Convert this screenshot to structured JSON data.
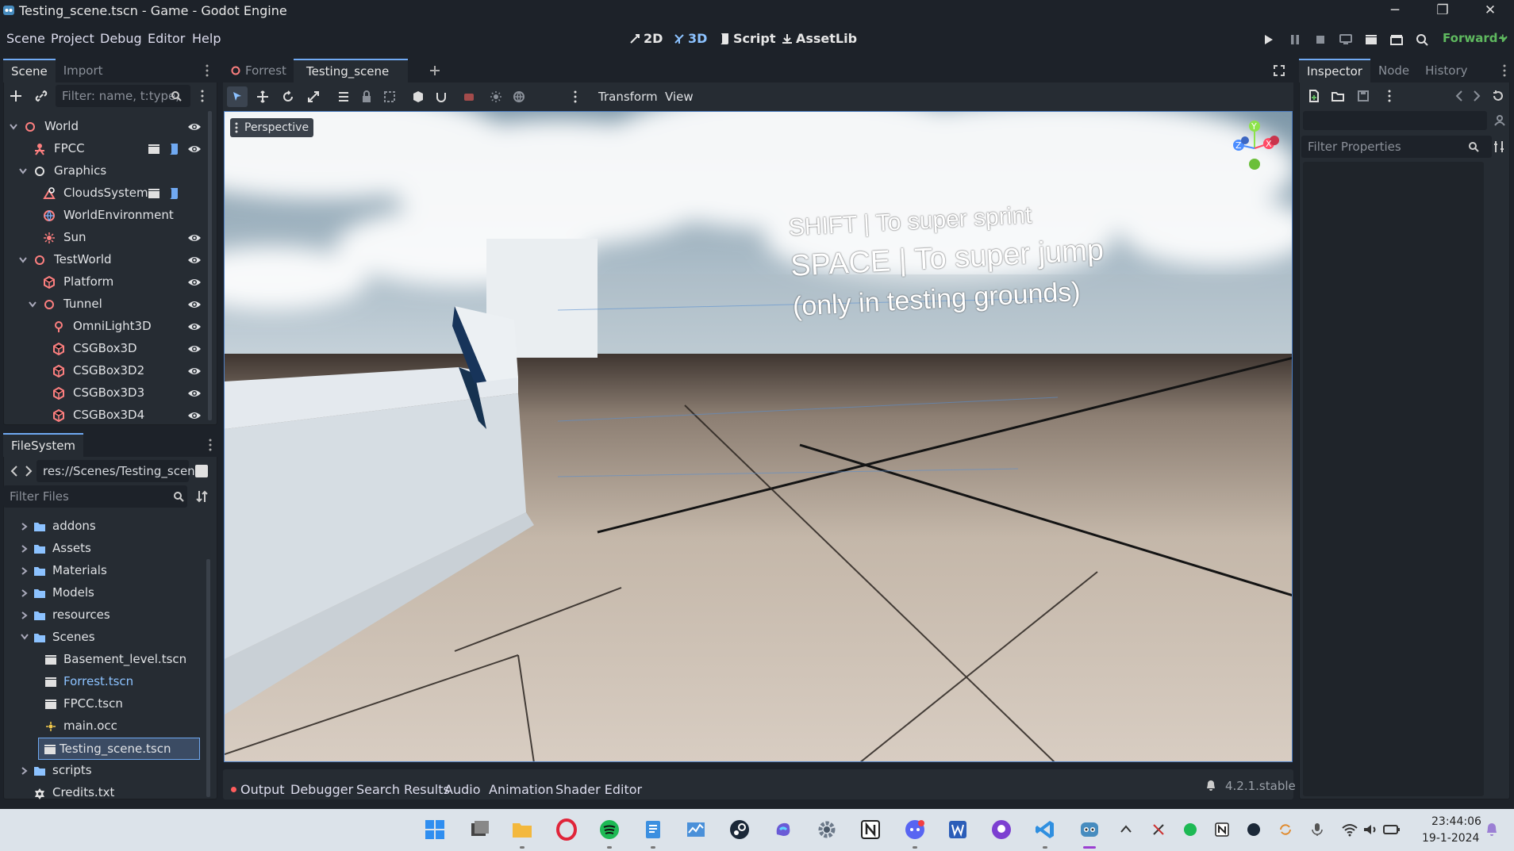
{
  "window": {
    "title": "Testing_scene.tscn - Game - Godot Engine",
    "minimize": "─",
    "maximize": "❐",
    "close": "✕"
  },
  "menu": [
    "Scene",
    "Project",
    "Debug",
    "Editor",
    "Help"
  ],
  "workspaces": {
    "w2d": "2D",
    "w3d": "3D",
    "script": "Script",
    "assetlib": "AssetLib",
    "active": "3D"
  },
  "renderer": "Forward+",
  "scene_dock": {
    "tabs": [
      "Scene",
      "Import"
    ],
    "filter_placeholder": "Filter: name, t:type,",
    "nodes": [
      {
        "name": "World",
        "depth": 0,
        "icon": "node3d",
        "color": "#fc7f7f",
        "eye": true,
        "expand": "open"
      },
      {
        "name": "FPCC",
        "depth": 1,
        "icon": "character",
        "color": "#fc7f7f",
        "eye": true,
        "extras": [
          "clapper",
          "script"
        ]
      },
      {
        "name": "Graphics",
        "depth": 1,
        "icon": "node",
        "color": "#e0e0e0",
        "eye": false,
        "expand": "open"
      },
      {
        "name": "CloudsSystem",
        "depth": 2,
        "icon": "custom",
        "color": "#fc7f7f",
        "eye": false,
        "extras": [
          "clapper",
          "script"
        ]
      },
      {
        "name": "WorldEnvironment",
        "depth": 2,
        "icon": "globe",
        "color": "#fc7f7f",
        "eye": false
      },
      {
        "name": "Sun",
        "depth": 2,
        "icon": "sun",
        "color": "#fc7f7f",
        "eye": true
      },
      {
        "name": "TestWorld",
        "depth": 1,
        "icon": "node3d",
        "color": "#fc7f7f",
        "eye": true,
        "expand": "open"
      },
      {
        "name": "Platform",
        "depth": 2,
        "icon": "csg",
        "color": "#fc7f7f",
        "eye": true
      },
      {
        "name": "Tunnel",
        "depth": 2,
        "icon": "node3d",
        "color": "#fc7f7f",
        "eye": true,
        "expand": "open"
      },
      {
        "name": "OmniLight3D",
        "depth": 3,
        "icon": "omni",
        "color": "#fc7f7f",
        "eye": true
      },
      {
        "name": "CSGBox3D",
        "depth": 3,
        "icon": "csg",
        "color": "#fc7f7f",
        "eye": true
      },
      {
        "name": "CSGBox3D2",
        "depth": 3,
        "icon": "csg",
        "color": "#fc7f7f",
        "eye": true
      },
      {
        "name": "CSGBox3D3",
        "depth": 3,
        "icon": "csg",
        "color": "#fc7f7f",
        "eye": true
      },
      {
        "name": "CSGBox3D4",
        "depth": 3,
        "icon": "csg",
        "color": "#fc7f7f",
        "eye": true
      }
    ]
  },
  "filesystem": {
    "tab": "FileSystem",
    "path": "res://Scenes/Testing_scene.",
    "filter_placeholder": "Filter Files",
    "items": [
      {
        "name": "addons",
        "type": "folder",
        "depth": 0
      },
      {
        "name": "Assets",
        "type": "folder",
        "depth": 0
      },
      {
        "name": "Materials",
        "type": "folder",
        "depth": 0
      },
      {
        "name": "Models",
        "type": "folder",
        "depth": 0
      },
      {
        "name": "resources",
        "type": "folder",
        "depth": 0
      },
      {
        "name": "Scenes",
        "type": "folder",
        "depth": 0,
        "open": true
      },
      {
        "name": "Basement_level.tscn",
        "type": "scene",
        "depth": 1
      },
      {
        "name": "Forrest.tscn",
        "type": "scene",
        "depth": 1,
        "highlight": true
      },
      {
        "name": "FPCC.tscn",
        "type": "scene",
        "depth": 1
      },
      {
        "name": "main.occ",
        "type": "occ",
        "depth": 1
      },
      {
        "name": "Testing_scene.tscn",
        "type": "scene",
        "depth": 1,
        "selected": true
      },
      {
        "name": "scripts",
        "type": "folder",
        "depth": 0
      },
      {
        "name": "Credits.txt",
        "type": "text",
        "depth": 0
      }
    ]
  },
  "editor_tabs": [
    {
      "label": "Forrest",
      "active": false
    },
    {
      "label": "Testing_scene",
      "active": true
    }
  ],
  "viewport": {
    "menus": [
      "Transform",
      "View"
    ],
    "perspective_label": "Perspective",
    "gizmo": {
      "y": "Y",
      "x": "X",
      "z": "Z"
    },
    "overlay_lines": [
      "SHIFT | To super sprint",
      "SPACE | To super jump",
      "(only in testing grounds)"
    ]
  },
  "bottom_panel": {
    "tabs": [
      "Output",
      "Debugger",
      "Search Results",
      "Audio",
      "Animation",
      "Shader Editor"
    ],
    "version": "4.2.1.stable"
  },
  "inspector": {
    "tabs": [
      "Inspector",
      "Node",
      "History"
    ],
    "filter_placeholder": "Filter Properties"
  },
  "taskbar": {
    "apps": [
      "windows-start",
      "task-view",
      "file-explorer",
      "opera",
      "spotify",
      "notepad",
      "task-manager",
      "steam",
      "copilot",
      "settings",
      "notion",
      "discord",
      "word",
      "github-desktop",
      "vscode",
      "godot"
    ],
    "time": "23:44:06",
    "date": "19-1-2024"
  },
  "colors": {
    "accent": "#70a9f2",
    "node3d": "#fc7f7f",
    "folder": "#8cc2ff",
    "run": "#e0e0e0"
  }
}
